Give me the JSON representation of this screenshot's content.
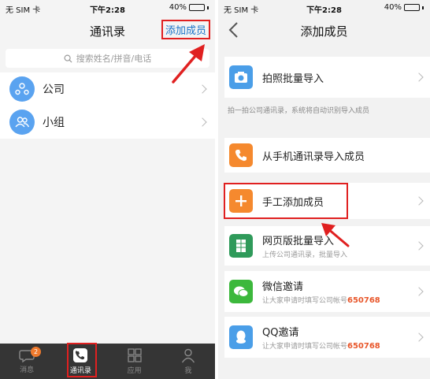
{
  "status": {
    "carrier": "无 SIM 卡",
    "time": "下午2:28",
    "battery": "40%",
    "battery_level": 0.4
  },
  "left": {
    "title": "通讯录",
    "add_member": "添加成员",
    "search_placeholder": "搜索姓名/拼音/电话",
    "items": [
      {
        "label": "公司",
        "icon": "company-icon"
      },
      {
        "label": "小组",
        "icon": "group-icon"
      }
    ],
    "tabs": [
      {
        "label": "消息",
        "icon": "message-icon",
        "badge": "2"
      },
      {
        "label": "通讯录",
        "icon": "contacts-icon"
      },
      {
        "label": "应用",
        "icon": "apps-icon"
      },
      {
        "label": "我",
        "icon": "profile-icon"
      }
    ],
    "active_tab": "通讯录"
  },
  "right": {
    "title": "添加成员",
    "photo_import": {
      "title": "拍照批量导入",
      "hint": "拍一拍公司通讯录，系统将自动识别导入成员"
    },
    "phone_import": {
      "title": "从手机通讯录导入成员"
    },
    "manual_add": {
      "title": "手工添加成员"
    },
    "web_import": {
      "title": "网页版批量导入",
      "subtitle": "上传公司通讯录，批量导入"
    },
    "wechat_invite": {
      "title": "微信邀请",
      "subtitle": "让大家申请时填写公司帐号",
      "account": "650768"
    },
    "qq_invite": {
      "title": "QQ邀请",
      "subtitle": "让大家申请时填写公司帐号",
      "account": "650768"
    }
  },
  "colors": {
    "accent_blue": "#1a73c8",
    "highlight_red": "#e02020",
    "orange": "#f5892e",
    "excel_green": "#2f9a5a",
    "wechat_green": "#3cb83c",
    "qq_blue": "#4a9ee8",
    "tabbar": "#353535"
  }
}
